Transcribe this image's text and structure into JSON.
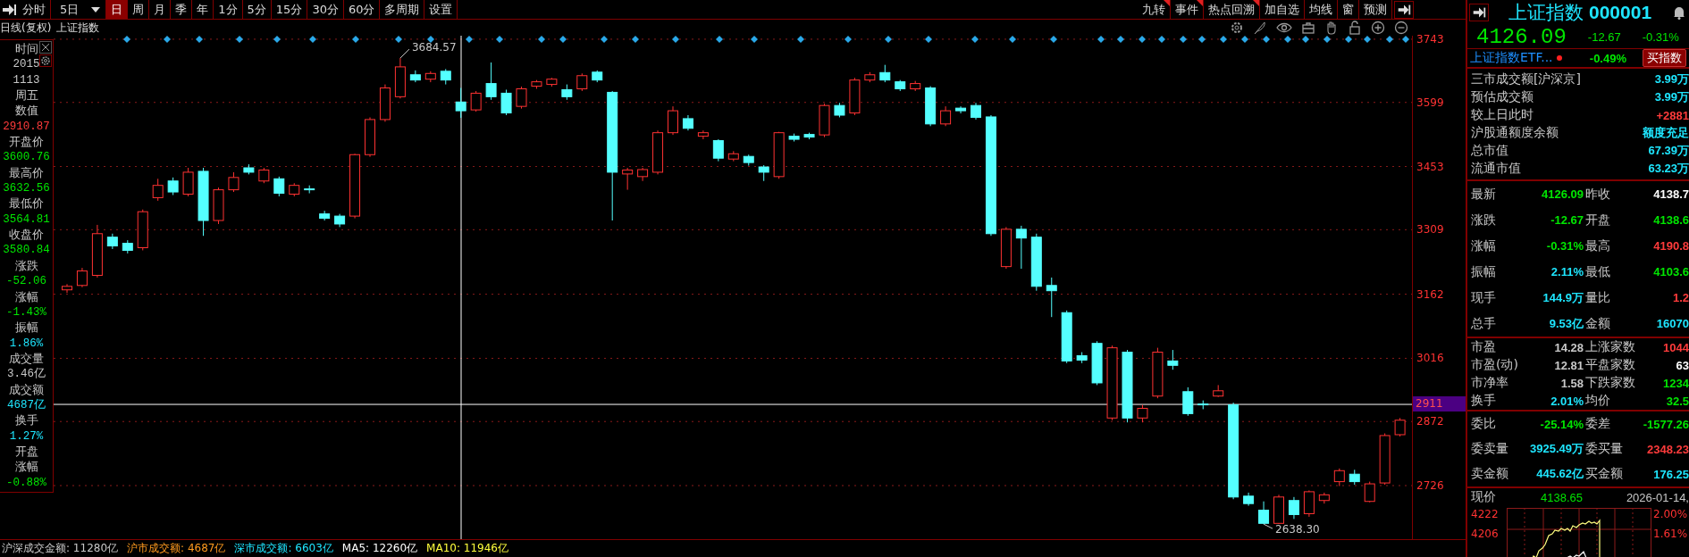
{
  "toolbar": {
    "periods": [
      {
        "label": "分时",
        "selected": false,
        "kind": "tab"
      },
      {
        "label": "5日",
        "selected": false,
        "kind": "dropdown"
      },
      {
        "label": "日",
        "selected": true,
        "kind": "tab"
      },
      {
        "label": "周",
        "selected": false,
        "kind": "tab"
      },
      {
        "label": "月",
        "selected": false,
        "kind": "tab"
      },
      {
        "label": "季",
        "selected": false,
        "kind": "tab"
      },
      {
        "label": "年",
        "selected": false,
        "kind": "tab"
      },
      {
        "label": "1分",
        "selected": false,
        "kind": "tab"
      },
      {
        "label": "5分",
        "selected": false,
        "kind": "tab"
      },
      {
        "label": "15分",
        "selected": false,
        "kind": "tab"
      },
      {
        "label": "30分",
        "selected": false,
        "kind": "tab"
      },
      {
        "label": "60分",
        "selected": false,
        "kind": "tab"
      },
      {
        "label": "多周期",
        "selected": false,
        "kind": "tab"
      },
      {
        "label": "设置",
        "selected": false,
        "kind": "tab"
      }
    ],
    "tools": [
      {
        "label": "九转",
        "flagged": true
      },
      {
        "label": "事件",
        "flagged": true
      },
      {
        "label": "热点回溯",
        "flagged": true
      },
      {
        "label": "加自选",
        "flagged": false
      },
      {
        "label": "均线",
        "flagged": false
      },
      {
        "label": "窗",
        "flagged": false
      },
      {
        "label": "预测",
        "flagged": false
      }
    ]
  },
  "chart": {
    "period_label": "日线(复权)",
    "symbol": "上证指数",
    "cursor_value": "2911",
    "high_label": "3684.57",
    "low_label": "2638.30",
    "chart_data": {
      "type": "candlestick",
      "grid": true,
      "ref_lines": [
        {
          "axis": "y",
          "value": 2911
        }
      ],
      "ylim": [
        2604,
        3751
      ],
      "yticks": [
        3743,
        3599,
        3453,
        3309,
        3162,
        3016,
        2872,
        2726
      ],
      "ohlc": [
        [
          3172,
          3185,
          3165,
          3180
        ],
        [
          3182,
          3222,
          3178,
          3215
        ],
        [
          3205,
          3320,
          3200,
          3300
        ],
        [
          3292,
          3300,
          3265,
          3272
        ],
        [
          3278,
          3285,
          3255,
          3262
        ],
        [
          3268,
          3355,
          3262,
          3350
        ],
        [
          3382,
          3425,
          3375,
          3410
        ],
        [
          3420,
          3428,
          3388,
          3395
        ],
        [
          3390,
          3450,
          3385,
          3440
        ],
        [
          3442,
          3450,
          3295,
          3330
        ],
        [
          3330,
          3405,
          3322,
          3400
        ],
        [
          3400,
          3440,
          3395,
          3428
        ],
        [
          3450,
          3458,
          3435,
          3440
        ],
        [
          3420,
          3450,
          3415,
          3445
        ],
        [
          3425,
          3430,
          3385,
          3392
        ],
        [
          3390,
          3415,
          3385,
          3410
        ],
        [
          3402,
          3410,
          3392,
          3400
        ],
        [
          3345,
          3352,
          3330,
          3335
        ],
        [
          3340,
          3345,
          3315,
          3322
        ],
        [
          3340,
          3482,
          3335,
          3480
        ],
        [
          3480,
          3565,
          3475,
          3560
        ],
        [
          3560,
          3640,
          3555,
          3632
        ],
        [
          3612,
          3700,
          3608,
          3680
        ],
        [
          3662,
          3672,
          3645,
          3650
        ],
        [
          3652,
          3670,
          3645,
          3665
        ],
        [
          3670,
          3675,
          3640,
          3650
        ],
        [
          3600,
          3632,
          3564,
          3580
        ],
        [
          3582,
          3625,
          3578,
          3620
        ],
        [
          3642,
          3690,
          3605,
          3612
        ],
        [
          3620,
          3628,
          3570,
          3575
        ],
        [
          3590,
          3635,
          3585,
          3630
        ],
        [
          3636,
          3650,
          3630,
          3646
        ],
        [
          3640,
          3655,
          3635,
          3652
        ],
        [
          3628,
          3640,
          3605,
          3612
        ],
        [
          3630,
          3665,
          3625,
          3660
        ],
        [
          3668,
          3672,
          3645,
          3650
        ],
        [
          3622,
          3625,
          3330,
          3440
        ],
        [
          3436,
          3450,
          3400,
          3445
        ],
        [
          3430,
          3450,
          3420,
          3446
        ],
        [
          3440,
          3535,
          3435,
          3530
        ],
        [
          3530,
          3590,
          3525,
          3580
        ],
        [
          3562,
          3570,
          3535,
          3540
        ],
        [
          3522,
          3535,
          3515,
          3530
        ],
        [
          3512,
          3515,
          3465,
          3472
        ],
        [
          3470,
          3488,
          3465,
          3482
        ],
        [
          3476,
          3480,
          3455,
          3462
        ],
        [
          3452,
          3456,
          3420,
          3440
        ],
        [
          3430,
          3532,
          3425,
          3530
        ],
        [
          3522,
          3528,
          3510,
          3515
        ],
        [
          3526,
          3530,
          3515,
          3520
        ],
        [
          3525,
          3596,
          3520,
          3592
        ],
        [
          3592,
          3598,
          3565,
          3570
        ],
        [
          3575,
          3655,
          3570,
          3650
        ],
        [
          3650,
          3668,
          3645,
          3662
        ],
        [
          3667,
          3684.57,
          3645,
          3650
        ],
        [
          3646,
          3650,
          3625,
          3630
        ],
        [
          3630,
          3648,
          3625,
          3642
        ],
        [
          3632,
          3636,
          3545,
          3550
        ],
        [
          3550,
          3590,
          3545,
          3580
        ],
        [
          3586,
          3590,
          3574,
          3580
        ],
        [
          3592,
          3598,
          3560,
          3565
        ],
        [
          3566,
          3570,
          3295,
          3300
        ],
        [
          3225,
          3315,
          3220,
          3310
        ],
        [
          3310,
          3318,
          3220,
          3290
        ],
        [
          3292,
          3300,
          3170,
          3180
        ],
        [
          3182,
          3200,
          3110,
          3170
        ],
        [
          3120,
          3125,
          3005,
          3010
        ],
        [
          3022,
          3030,
          3005,
          3012
        ],
        [
          3050,
          3055,
          2955,
          2960
        ],
        [
          2880,
          3045,
          2875,
          3040
        ],
        [
          3030,
          3035,
          2870,
          2880
        ],
        [
          2880,
          2910,
          2870,
          2902
        ],
        [
          2930,
          3040,
          2925,
          3030
        ],
        [
          3010,
          3035,
          2990,
          3000
        ],
        [
          2940,
          2950,
          2885,
          2890
        ],
        [
          2912,
          2920,
          2900,
          2910
        ],
        [
          2930,
          2955,
          2928,
          2942
        ],
        [
          2910,
          2915,
          2695,
          2700
        ],
        [
          2702,
          2710,
          2680,
          2685
        ],
        [
          2670,
          2690,
          2638.3,
          2640
        ],
        [
          2640,
          2705,
          2638.5,
          2700
        ],
        [
          2692,
          2700,
          2650,
          2660
        ],
        [
          2662,
          2715,
          2655,
          2712
        ],
        [
          2692,
          2710,
          2685,
          2705
        ],
        [
          2735,
          2765,
          2725,
          2760
        ],
        [
          2752,
          2762,
          2728,
          2735
        ],
        [
          2690,
          2735,
          2688,
          2730
        ],
        [
          2732,
          2845,
          2728,
          2840
        ],
        [
          2842,
          2880,
          2838,
          2875
        ]
      ]
    }
  },
  "crosshair_panel": {
    "rows": [
      {
        "text": "时间",
        "kind": "label"
      },
      {
        "text": "2015",
        "kind": "value",
        "color": "#c8c8c8"
      },
      {
        "text": "1113",
        "kind": "value",
        "color": "#c8c8c8"
      },
      {
        "text": "周五",
        "kind": "label"
      },
      {
        "text": "数值",
        "kind": "label"
      },
      {
        "text": "2910.87",
        "kind": "value",
        "color": "#ff3b3b"
      },
      {
        "text": "开盘价",
        "kind": "label"
      },
      {
        "text": "3600.76",
        "kind": "value",
        "color": "#00e600"
      },
      {
        "text": "最高价",
        "kind": "label"
      },
      {
        "text": "3632.56",
        "kind": "value",
        "color": "#00e600"
      },
      {
        "text": "最低价",
        "kind": "label"
      },
      {
        "text": "3564.81",
        "kind": "value",
        "color": "#00e600"
      },
      {
        "text": "收盘价",
        "kind": "label"
      },
      {
        "text": "3580.84",
        "kind": "value",
        "color": "#00e600"
      },
      {
        "text": "涨跌",
        "kind": "label"
      },
      {
        "text": "-52.06",
        "kind": "value",
        "color": "#00e600"
      },
      {
        "text": "涨幅",
        "kind": "label"
      },
      {
        "text": "-1.43%",
        "kind": "value",
        "color": "#00e600"
      },
      {
        "text": "振幅",
        "kind": "label"
      },
      {
        "text": "1.86%",
        "kind": "value",
        "color": "#1ee6ff"
      },
      {
        "text": "成交量",
        "kind": "label"
      },
      {
        "text": "3.46亿",
        "kind": "value",
        "color": "#c8c8c8"
      },
      {
        "text": "成交额",
        "kind": "label"
      },
      {
        "text": "4687亿",
        "kind": "value",
        "color": "#1ee6ff"
      },
      {
        "text": "换手",
        "kind": "label"
      },
      {
        "text": "1.27%",
        "kind": "value",
        "color": "#1ee6ff"
      },
      {
        "text": "开盘",
        "kind": "label"
      },
      {
        "text": "涨幅",
        "kind": "label"
      },
      {
        "text": "-0.88%",
        "kind": "value",
        "color": "#00e600"
      }
    ]
  },
  "footer": {
    "items": [
      {
        "text": "沪深成交金额: 11280亿",
        "color": "#c8c8c8"
      },
      {
        "text": "沪市成交额: 4687亿",
        "color": "#ff9a1e"
      },
      {
        "text": "深市成交额: 6603亿",
        "color": "#1ee6ff"
      },
      {
        "text": "MA5: 12260亿",
        "color": "#ffffff"
      },
      {
        "text": "MA10: 11946亿",
        "color": "#ffff3c"
      }
    ]
  },
  "quote_panel": {
    "name": "上证指数",
    "code": "000001",
    "price": "4126.09",
    "change": "-12.67",
    "change_pct": "-0.31%",
    "color": "#00e600",
    "etf": {
      "name": "上证指数ETF...",
      "change_pct": "-0.49%",
      "color": "#00e600",
      "button": "买指数"
    },
    "market": [
      {
        "label": "三市成交额[沪深京]",
        "value": "3.99万",
        "color": "#1ee6ff"
      },
      {
        "label": "预估成交额",
        "value": "3.99万",
        "color": "#1ee6ff"
      },
      {
        "label": "较上日此时",
        "value": "+2881",
        "color": "#ff3b3b"
      },
      {
        "label": "沪股通额度余额",
        "value": "额度充足",
        "color": "#1ee6ff"
      },
      {
        "label": "总市值",
        "value": "67.39万",
        "color": "#1ee6ff"
      },
      {
        "label": "流通市值",
        "value": "63.23万",
        "color": "#1ee6ff"
      }
    ],
    "sections": [
      {
        "kind": "tall",
        "rows": [
          {
            "cells": [
              {
                "label": "最新",
                "value": "4126.09",
                "color": "#00e600"
              },
              {
                "label": "昨收",
                "value": "4138.7",
                "color": "#ffffff"
              }
            ]
          },
          {
            "cells": [
              {
                "label": "涨跌",
                "value": "-12.67",
                "color": "#00e600"
              },
              {
                "label": "开盘",
                "value": "4138.6",
                "color": "#00e600"
              }
            ]
          },
          {
            "cells": [
              {
                "label": "涨幅",
                "value": "-0.31%",
                "color": "#00e600"
              },
              {
                "label": "最高",
                "value": "4190.8",
                "color": "#ff3b3b"
              }
            ]
          },
          {
            "cells": [
              {
                "label": "振幅",
                "value": "2.11%",
                "color": "#1ee6ff"
              },
              {
                "label": "最低",
                "value": "4103.6",
                "color": "#00e600"
              }
            ]
          },
          {
            "cells": [
              {
                "label": "现手",
                "value": "144.9万",
                "color": "#1ee6ff"
              },
              {
                "label": "量比",
                "value": "1.2",
                "color": "#ff3b3b"
              }
            ]
          },
          {
            "cells": [
              {
                "label": "总手",
                "value": "9.53亿",
                "color": "#1ee6ff"
              },
              {
                "label": "金额",
                "value": "16070",
                "color": "#1ee6ff"
              }
            ]
          }
        ]
      },
      {
        "kind": "compact",
        "rows": [
          {
            "cells": [
              {
                "label": "市盈",
                "value": "14.28",
                "color": "#c8c8c8"
              },
              {
                "label": "上涨家数",
                "value": "1044",
                "color": "#ff3b3b"
              }
            ]
          },
          {
            "cells": [
              {
                "label": "市盈(动)",
                "value": "12.81",
                "color": "#c8c8c8"
              },
              {
                "label": "平盘家数",
                "value": "63",
                "color": "#ffffff"
              }
            ]
          },
          {
            "cells": [
              {
                "label": "市净率",
                "value": "1.58",
                "color": "#c8c8c8"
              },
              {
                "label": "下跌家数",
                "value": "1234",
                "color": "#00e600"
              }
            ]
          },
          {
            "cells": [
              {
                "label": "换手",
                "value": "2.01%",
                "color": "#1ee6ff"
              },
              {
                "label": "均价",
                "value": "32.5",
                "color": "#00e600"
              }
            ]
          }
        ]
      },
      {
        "kind": "wide",
        "rows": [
          {
            "cells": [
              {
                "label": "委比",
                "value": "-25.14%",
                "color": "#00e600"
              },
              {
                "label": "委差",
                "value": "-1577.26",
                "color": "#00e600"
              }
            ]
          },
          {
            "cells": [
              {
                "label": "委卖量",
                "value": "3925.49万",
                "color": "#1ee6ff"
              },
              {
                "label": "委买量",
                "value": "2348.23",
                "color": "#ff3b3b"
              }
            ]
          },
          {
            "cells": [
              {
                "label": "卖金额",
                "value": "445.62亿",
                "color": "#1ee6ff"
              },
              {
                "label": "买金额",
                "value": "176.25",
                "color": "#1ee6ff"
              }
            ]
          }
        ]
      }
    ],
    "intraday": {
      "label": "现价",
      "price": "4138.65",
      "color": "#00e600",
      "date": "2026-01-14,",
      "left_ticks": [
        "4222",
        "4206"
      ],
      "right_ticks": [
        "2.00%",
        "1.61%"
      ]
    }
  }
}
